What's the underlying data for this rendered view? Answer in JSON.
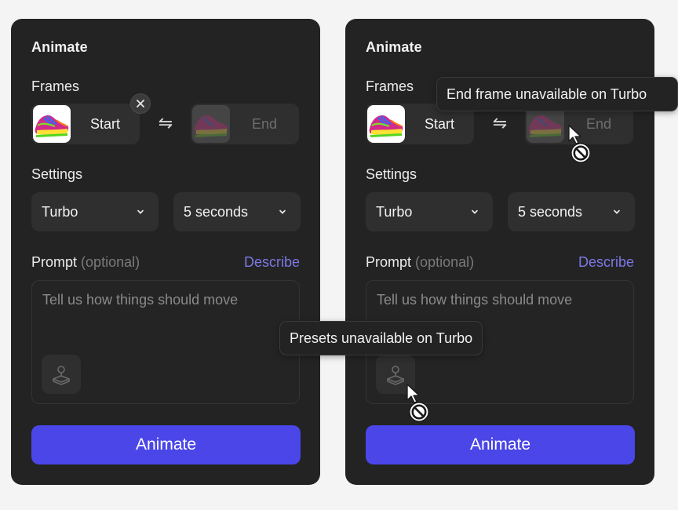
{
  "panels": [
    {
      "heading": "Animate",
      "frames_label": "Frames",
      "start_label": "Start",
      "end_label": "End",
      "settings_label": "Settings",
      "model": "Turbo",
      "duration": "5 seconds",
      "prompt_label": "Prompt",
      "prompt_optional": "(optional)",
      "describe_label": "Describe",
      "prompt_placeholder": "Tell us how things should move",
      "animate_label": "Animate"
    },
    {
      "heading": "Animate",
      "frames_label": "Frames",
      "start_label": "Start",
      "end_label": "End",
      "settings_label": "Settings",
      "model": "Turbo",
      "duration": "5 seconds",
      "prompt_label": "Prompt",
      "prompt_optional": "(optional)",
      "describe_label": "Describe",
      "prompt_placeholder": "Tell us how things should move",
      "animate_label": "Animate"
    }
  ],
  "tooltips": {
    "end_frame": "End frame unavailable on Turbo",
    "presets": "Presets unavailable on Turbo"
  },
  "icons": {
    "swap": "swap-arrows-icon",
    "close": "close-icon",
    "chevron": "chevron-down-icon",
    "preset": "preset-joystick-icon",
    "cursor": "not-allowed-cursor-icon"
  },
  "colors": {
    "panel_bg": "#232323",
    "accent": "#4b46e8",
    "describe": "#7d78e6"
  }
}
